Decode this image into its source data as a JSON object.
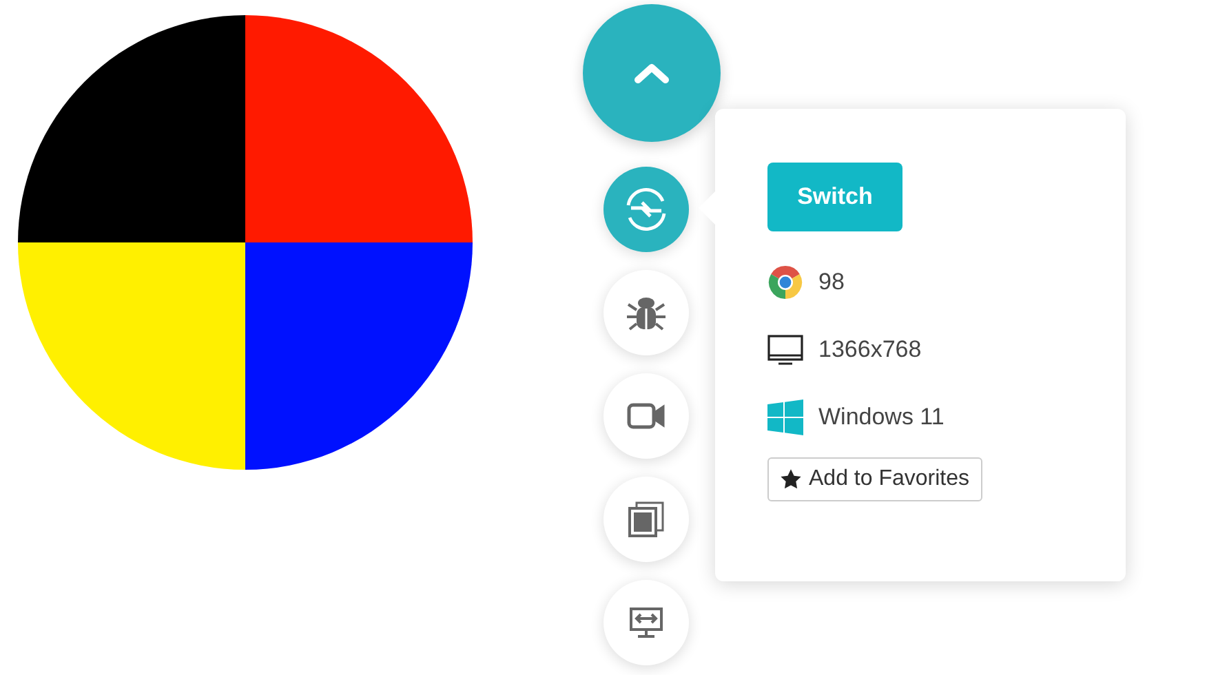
{
  "tools": [
    {
      "kind": "switch",
      "selected": true
    },
    {
      "kind": "bug",
      "selected": false
    },
    {
      "kind": "video",
      "selected": false
    },
    {
      "kind": "screenshots",
      "selected": false
    },
    {
      "kind": "resolution",
      "selected": false
    }
  ],
  "popup": {
    "switch_button": "Switch",
    "browser_version": "98",
    "resolution": "1366x768",
    "os": "Windows 11",
    "favorites_button": "Add to Favorites"
  }
}
